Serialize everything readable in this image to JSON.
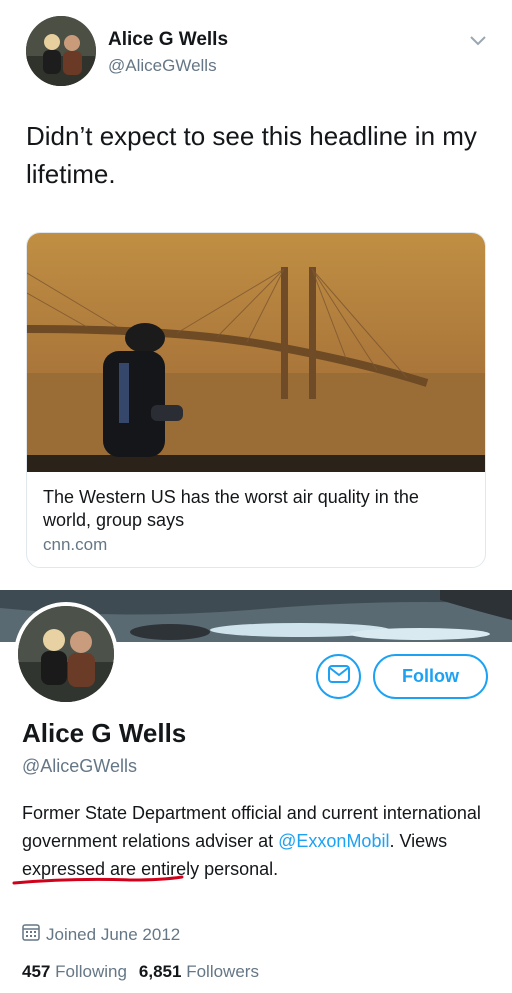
{
  "tweet": {
    "author_name": "Alice G Wells",
    "author_handle": "@AliceGWells",
    "text": "Didn’t expect to see this headline in my lifetime.",
    "card": {
      "title": "The Western US has the worst air quality in the world, group says",
      "domain": "cnn.com"
    }
  },
  "profile": {
    "name": "Alice G Wells",
    "handle": "@AliceGWells",
    "follow_label": "Follow",
    "bio_prefix": "Former State Department official and current international government relations adviser at ",
    "bio_mention": "@ExxonMobil",
    "bio_suffix": ". Views expressed are entirely personal.",
    "joined": "Joined June 2012",
    "following_count": "457",
    "following_label": "Following",
    "followers_count": "6,851",
    "followers_label": "Followers"
  },
  "colors": {
    "accent": "#1da1f2",
    "secondary_text": "#657786",
    "annotation": "#d0021b"
  },
  "icons": [
    "chevron-down-icon",
    "mail-icon",
    "calendar-icon"
  ]
}
